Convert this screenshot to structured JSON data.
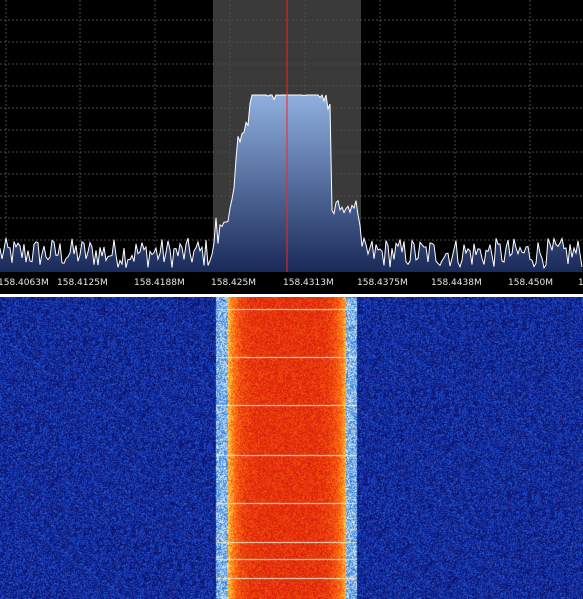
{
  "spectrum": {
    "trace_color": "#ffffff",
    "fill_top_color": "#8fb0de",
    "fill_bottom_color": "#1a2a5a",
    "grid_color": "#4a4a4a",
    "filter_band_color": "#3a3a3a",
    "tuning_line_color": "#ff2020"
  },
  "frequency_axis": {
    "labels": [
      "158.4063M",
      "158.4125M",
      "158.4188M",
      "158.425M",
      "158.4313M",
      "158.4375M",
      "158.4438M",
      "158.450M",
      "1"
    ]
  },
  "waterfall": {
    "background_color": "#0a0e6e",
    "signal_core_color": "#ff4a00",
    "signal_edge_color": "#ffe14a",
    "noise_color": "#2050c0"
  }
}
